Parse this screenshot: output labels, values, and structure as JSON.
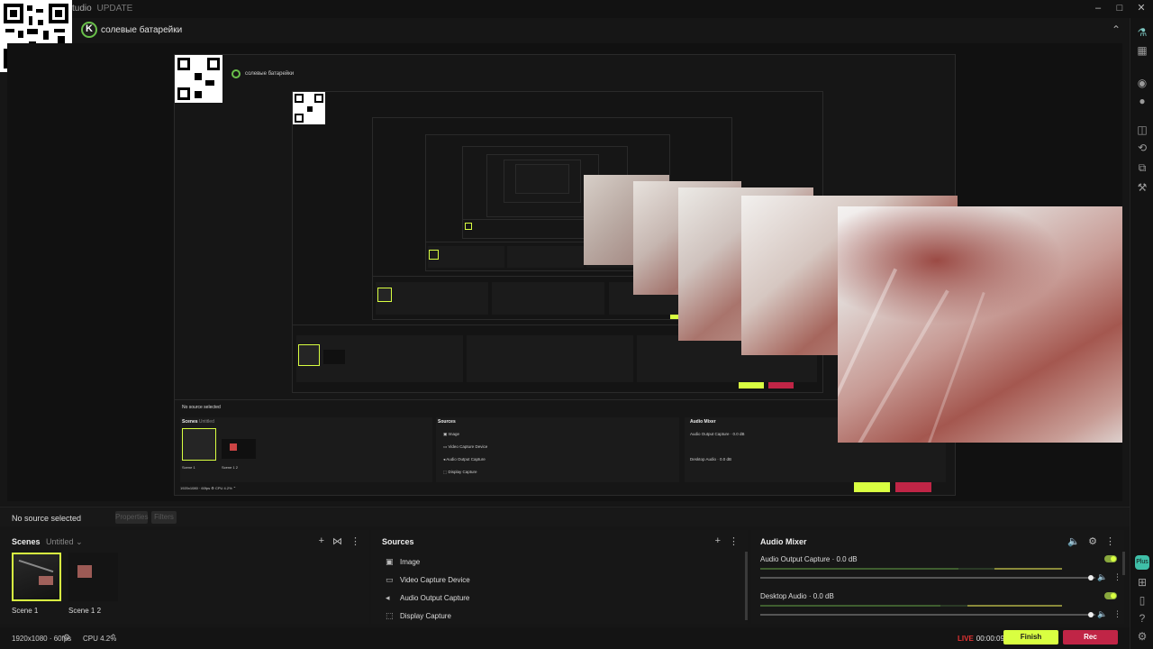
{
  "window": {
    "title": "tudio",
    "update_badge": "UPDATE",
    "controls": [
      "–",
      "□",
      "✕"
    ]
  },
  "account": {
    "name": "солевые батарейки",
    "collapse_icon": "chevron-up-icon"
  },
  "preview": {
    "description_icon": "nested-preview"
  },
  "source_bar": {
    "status": "No source selected",
    "properties_label": "Properties",
    "filters_label": "Filters"
  },
  "scenes": {
    "title": "Scenes",
    "collection": "Untitled",
    "items": [
      {
        "label": "Scene 1",
        "active": true
      },
      {
        "label": "Scene 1 2",
        "active": false
      }
    ]
  },
  "sources": {
    "title": "Sources",
    "items": [
      {
        "label": "Image",
        "icon": "image-icon"
      },
      {
        "label": "Video Capture Device",
        "icon": "camera-icon"
      },
      {
        "label": "Audio Output Capture",
        "icon": "speaker-icon"
      },
      {
        "label": "Display Capture",
        "icon": "display-icon"
      }
    ]
  },
  "mixer": {
    "title": "Audio Mixer",
    "tracks": [
      {
        "name": "Audio Output Capture",
        "level": "0.0 dB"
      },
      {
        "name": "Desktop Audio",
        "level": "0.0 dB"
      }
    ]
  },
  "status": {
    "resolution": "1920x1080 · 60fps",
    "cpu": "CPU 4.2%",
    "live_label": "LIVE",
    "timer": "00:00:09",
    "finish_label": "Finish",
    "rec_label": "Rec"
  },
  "colors": {
    "accent": "#d9ff41",
    "rec": "#c02546",
    "live": "#e53333",
    "brand_green": "#69c04a"
  }
}
